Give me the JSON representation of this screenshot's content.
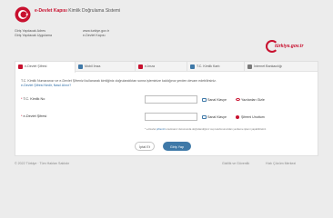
{
  "header": {
    "brand_name": "e-Devlet Kapısı",
    "brand_subtitle": "Kimlik Doğrulama Sistemi"
  },
  "subheader": {
    "col1": [
      "Giriş Yapılacak Adres",
      "Giriş Yapılacak Uygulama"
    ],
    "col2": [
      "www.turkiye.gov.tr",
      "e-Devlet Kapısı"
    ],
    "logo_text": "türkiye.gov.tr"
  },
  "tabs": [
    {
      "label": "e-Devlet Şifresi"
    },
    {
      "label": "Mobil İmza"
    },
    {
      "label": "e-İmza"
    },
    {
      "label": "T.C. Kimlik Kartı"
    },
    {
      "label": "İnternet Bankacılığı"
    }
  ],
  "info": {
    "text": "T.C. Kimlik Numaranızı ve e-Devlet Şifrenizi kullanarak kimliğiniz doğrulandıktan sonra işleminize kaldığınız yerden devam edebilirsiniz.",
    "link1": "e-Devlet Şifresi Nedir, Nasıl Alınır?"
  },
  "form": {
    "tc_label": "T.C. Kimlik No",
    "tc_value": "",
    "password_label": "e-Devlet Şifresi",
    "password_value": "",
    "keyboard_label": "Sanal Klavye",
    "clear_label": "Yazılanları Gizle",
    "forgot_label": "Şifremi Unuttum",
    "note_prefix": "* e-Devlet",
    "note_link": "şifrenizi",
    "note_suffix": "unutmanız durumunda doğrulandığınız cep telefonunuzdan yenileme işlemi yapabilirsiniz."
  },
  "buttons": {
    "cancel_label": "İptal Et",
    "login_label": "Giriş Yap"
  },
  "footer": {
    "copyright": "© 2022 Türkiye · Tüm Hakları Saklıdır",
    "link_privacy": "Gizlilik ve Güvenlik",
    "link_help": "Hızlı Çözüm Merkezi"
  },
  "colors": {
    "brand_red": "#c8102e",
    "primary_blue": "#3f79a8"
  }
}
